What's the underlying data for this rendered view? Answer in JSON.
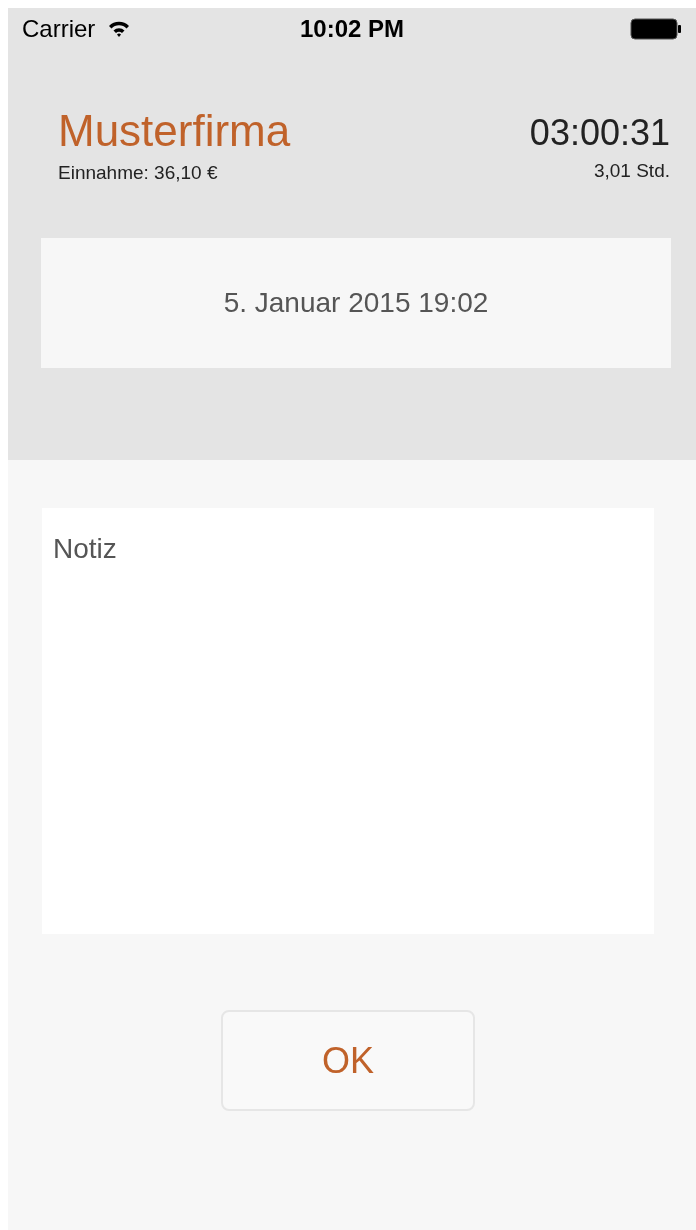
{
  "status_bar": {
    "carrier": "Carrier",
    "time": "10:02 PM"
  },
  "header": {
    "title": "Musterfirma",
    "income": "Einnahme: 36,10 €",
    "timer": "03:00:31",
    "hours": "3,01 Std."
  },
  "date": "5. Januar 2015 19:02",
  "note": {
    "placeholder": "Notiz"
  },
  "ok_button": "OK"
}
